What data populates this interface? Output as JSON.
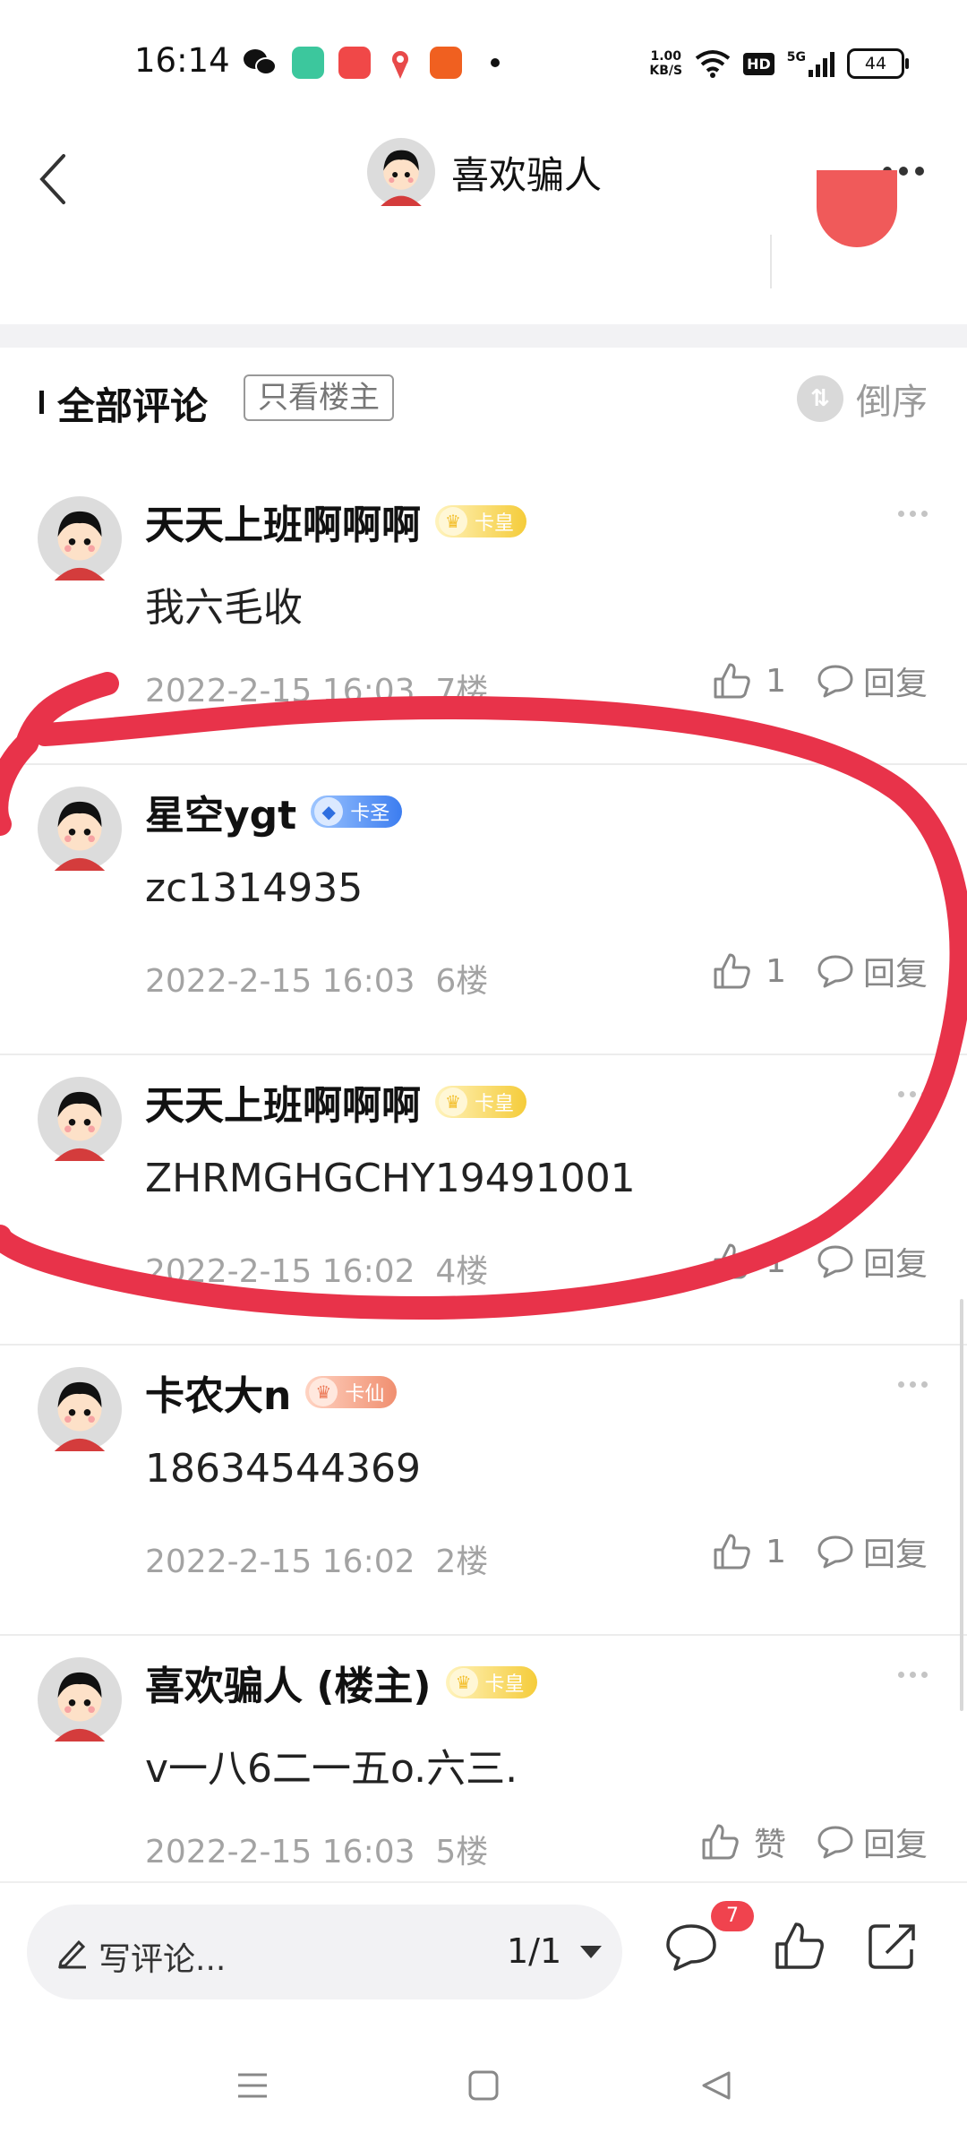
{
  "status_bar": {
    "time": "16:14",
    "net_speed_value": "1.00",
    "net_speed_unit": "KB/S",
    "hd_label": "HD",
    "network_label": "5G",
    "battery": "44",
    "notification_icons": [
      "wechat-icon",
      "green-app-icon",
      "video-app-icon",
      "map-app-icon",
      "taobao-icon"
    ]
  },
  "header": {
    "title": "喜欢骗人"
  },
  "comments_header": {
    "title": "全部评论",
    "only_op_label": "只看楼主",
    "sort_label": "倒序"
  },
  "badges": {
    "gold_label": "卡皇",
    "blue_label": "卡圣",
    "orange_label": "卡仙"
  },
  "comments": [
    {
      "name": "天天上班啊啊啊",
      "badge": "卡皇",
      "badge_color": "gold",
      "text": "我六毛收",
      "time": "2022-2-15 16:03",
      "floor": "7楼",
      "likes": "1",
      "reply_label": "回复"
    },
    {
      "name": "星空ygt",
      "badge": "卡圣",
      "badge_color": "blue",
      "text": "zc1314935",
      "time": "2022-2-15 16:03",
      "floor": "6楼",
      "likes": "1",
      "reply_label": "回复"
    },
    {
      "name": "天天上班啊啊啊",
      "badge": "卡皇",
      "badge_color": "gold",
      "text": "ZHRMGHGCHY19491001",
      "time": "2022-2-15 16:02",
      "floor": "4楼",
      "likes": "1",
      "reply_label": "回复"
    },
    {
      "name": "卡农大n",
      "badge": "卡仙",
      "badge_color": "orange",
      "text": "18634544369",
      "time": "2022-2-15 16:02",
      "floor": "2楼",
      "likes": "1",
      "reply_label": "回复"
    },
    {
      "name": "喜欢骗人 (楼主)",
      "badge": "卡皇",
      "badge_color": "gold",
      "text": "v一八6二一五o.六三.",
      "time": "2022-2-15 16:03",
      "floor": "5楼",
      "likes": "赞",
      "reply_label": "回复"
    }
  ],
  "bottom_bar": {
    "write_placeholder": "写评论...",
    "page_indicator": "1/1",
    "comment_count": "7"
  },
  "colors": {
    "annotation_red": "#e8334a",
    "badge_red": "#f0434e",
    "gold": "#f5cc3a",
    "blue": "#3c7df0",
    "orange": "#f08f70"
  }
}
